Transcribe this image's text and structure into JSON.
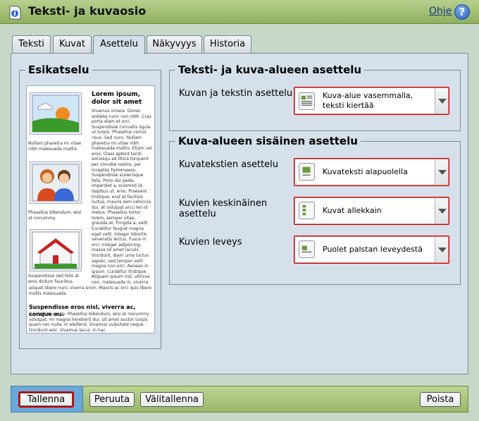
{
  "window": {
    "title": "Teksti- ja kuvaosio",
    "help_label": "Ohje",
    "help_icon": "?"
  },
  "tabs": [
    {
      "label": "Teksti"
    },
    {
      "label": "Kuvat"
    },
    {
      "label": "Asettelu",
      "active": true
    },
    {
      "label": "Näkyvyys"
    },
    {
      "label": "Historia"
    }
  ],
  "preview": {
    "legend": "Esikatselu",
    "title": "Lorem ipsum, dolor sit amet",
    "body": "Vivamus ornare. Donec sodales nunc non nibh. Cras porta diam et orci. Suspendisse convallis ligula ut turpis. Phasellus varius risus. Sed nunc. Nullam pharetra mi vitae nibh malesuada mattis. Etiam vel eros. Class aptent taciti sociosqu ad litora torquent per conubia nostra, per inceptos hymenaeos. Suspendisse scelerisque felis. Proin dui pede, imperdiet a, euismod id, dapibus ut, eros. Praesent tristique, erat at facilisis luctus, mauris sem vehicula dui, at volutpat arcu leo id metus. Phasellus tortor lorem, semper vitae, gravida at, fringilla a, velit. Curabitur feugiat magna eget velit. Integer lobortis venenatis lectus. Fusce in orci. Integer adipiscing, massa sit amet iaculis tincidunt, diam urna luctus sapien, sed tempor velit magna non orci. Aenean in ipsum. Curabitur tristique. Aliquam ipsum nisl, ultrices non, malesuada in, viverra sit amet, diam. Donec luctus, turpis in egestas tristique, nisi velit lobortis pede, vel",
    "body_cont": "aliquet libero nunc viverra enim. Mauris ac orci quis libero mollis malesuada.",
    "captions": [
      "Nullam pharetra mi vitae nibh malesuada mattis.",
      "Phasellus bibendum, wisi at nonummy.",
      "Suspendisse sed felis at eros dictum faucibus."
    ],
    "heading2": "Suspendisse eros nisl, viverra ac, conque eu.",
    "body2": "suscipit in, purus. Phasellus bibendum, wisi at nonummy volutpat, mi magna hendrerit dui, sit amet auctor turpis quam nec nulla. In eleifend. Vivamus vulputate neque tincidunt wisi. Vivamus lacus. In hac"
  },
  "layout_section": {
    "legend": "Teksti- ja kuva-alueen asettelu",
    "label": "Kuvan ja tekstin asettelu",
    "value": "Kuva-alue vasemmalla, teksti kiertää"
  },
  "inner_section": {
    "legend": "Kuva-alueen sisäinen asettelu",
    "fields": [
      {
        "label": "Kuvatekstien asettelu",
        "value": "Kuvateksti alapuolella"
      },
      {
        "label": "Kuvien keskinäinen asettelu",
        "value": "Kuvat allekkain"
      },
      {
        "label": "Kuvien leveys",
        "value": "Puolet palstan leveydestä"
      }
    ]
  },
  "buttons": {
    "save": "Tallenna",
    "cancel": "Peruuta",
    "draft": "Välitallenna",
    "delete": "Poista"
  }
}
